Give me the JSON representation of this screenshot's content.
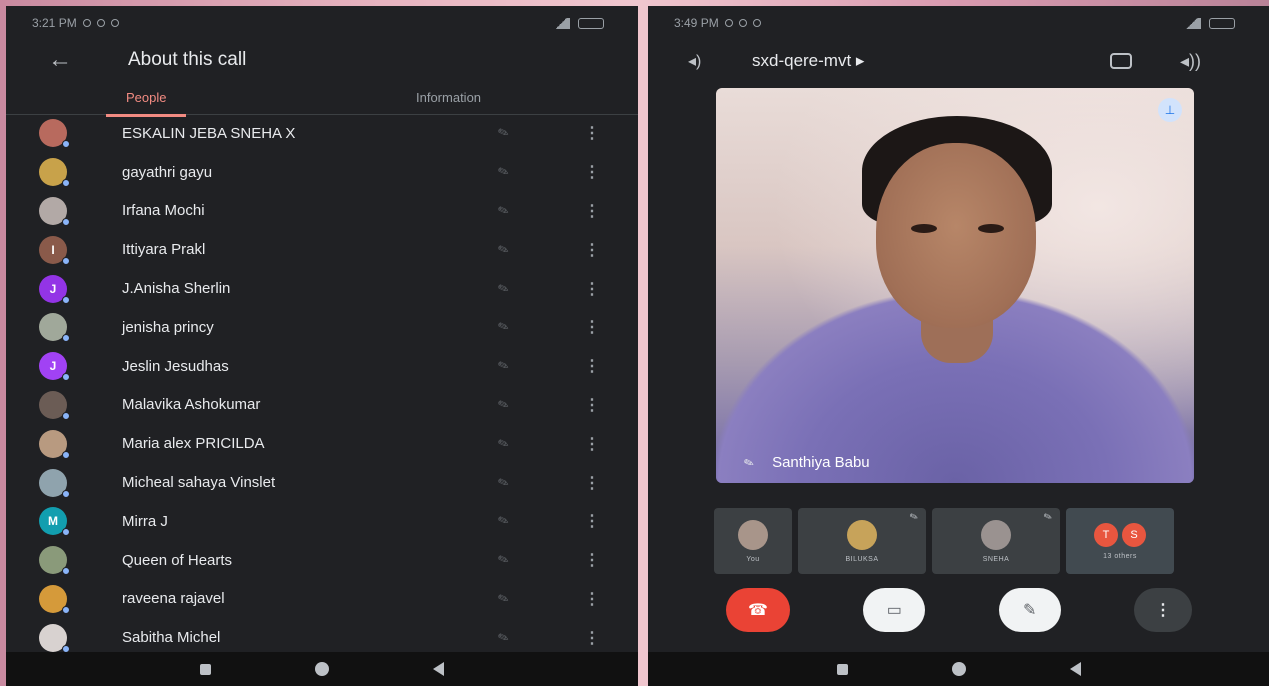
{
  "left": {
    "status_time": "3:21 PM",
    "title": "About this call",
    "tabs": {
      "people": "People",
      "information": "Information"
    },
    "participants": [
      {
        "name": "ESKALIN JEBA SNEHA X",
        "initial": "",
        "color": "#b86a5e"
      },
      {
        "name": "gayathri gayu",
        "initial": "",
        "color": "#c8a24a"
      },
      {
        "name": "Irfana Mochi",
        "initial": "",
        "color": "#b2a9a6"
      },
      {
        "name": "Ittiyara Prakl",
        "initial": "I",
        "color": "#8a5a4a"
      },
      {
        "name": "J.Anisha Sherlin",
        "initial": "J",
        "color": "#9334e6"
      },
      {
        "name": "jenisha princy",
        "initial": "",
        "color": "#a0a89a"
      },
      {
        "name": "Jeslin Jesudhas",
        "initial": "J",
        "color": "#a142f4"
      },
      {
        "name": "Malavika Ashokumar",
        "initial": "",
        "color": "#6b5c55"
      },
      {
        "name": "Maria alex PRICILDA",
        "initial": "",
        "color": "#b89a80"
      },
      {
        "name": "Micheal sahaya Vinslet",
        "initial": "",
        "color": "#8fa3ad"
      },
      {
        "name": "Mirra J",
        "initial": "M",
        "color": "#129eaf"
      },
      {
        "name": "Queen of Hearts",
        "initial": "",
        "color": "#8a9a7a"
      },
      {
        "name": "raveena rajavel",
        "initial": "",
        "color": "#d59a3a"
      },
      {
        "name": "Sabitha Michel",
        "initial": "",
        "color": "#d8d2d0"
      }
    ]
  },
  "right": {
    "status_time": "3:49 PM",
    "meeting_code": "sxd-qere-mvt",
    "speaker_name": "Santhiya Babu",
    "tiles": [
      {
        "label": "You"
      },
      {
        "label": "BILUKSA"
      },
      {
        "label": "SNEHA"
      }
    ],
    "others_tile": {
      "initials": [
        "T",
        "S"
      ],
      "label": "13 others"
    }
  }
}
